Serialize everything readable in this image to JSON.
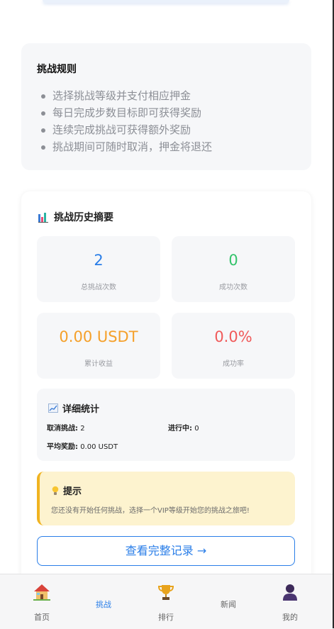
{
  "rules": {
    "title": "挑战规则",
    "items": [
      "选择挑战等级并支付相应押金",
      "每日完成步数目标即可获得奖励",
      "连续完成挑战可获得额外奖励",
      "挑战期间可随时取消，押金将退还"
    ]
  },
  "history": {
    "icon": "bar-chart-icon",
    "title": "挑战历史摘要",
    "stats": [
      {
        "value": "2",
        "label": "总挑战次数",
        "color": "#2a7ee8"
      },
      {
        "value": "0",
        "label": "成功次数",
        "color": "#34c36b"
      },
      {
        "value": "0.00 USDT",
        "label": "累计收益",
        "color": "#f5a02a"
      },
      {
        "value": "0.0%",
        "label": "成功率",
        "color": "#f05a5a"
      }
    ],
    "detail": {
      "icon": "trend-chart-icon",
      "title": "详细统计",
      "cancelled_label": "取消挑战:",
      "cancelled_value": "2",
      "ongoing_label": "进行中:",
      "ongoing_value": "0",
      "avg_reward_label": "平均奖励:",
      "avg_reward_value": "0.00 USDT"
    },
    "tip": {
      "icon": "lightbulb-icon",
      "title": "提示",
      "text": "您还没有开始任何挑战，选择一个VIP等级开始您的挑战之旅吧!"
    },
    "full_record_button": "查看完整记录 →"
  },
  "tabbar": {
    "items": [
      {
        "label": "首页",
        "icon": "home-icon",
        "active": false
      },
      {
        "label": "挑战",
        "icon": "",
        "active": true
      },
      {
        "label": "排行",
        "icon": "trophy-icon",
        "active": false
      },
      {
        "label": "新闻",
        "icon": "",
        "active": false
      },
      {
        "label": "我的",
        "icon": "user-icon",
        "active": false
      }
    ],
    "active_color": "#2a7ee8"
  }
}
